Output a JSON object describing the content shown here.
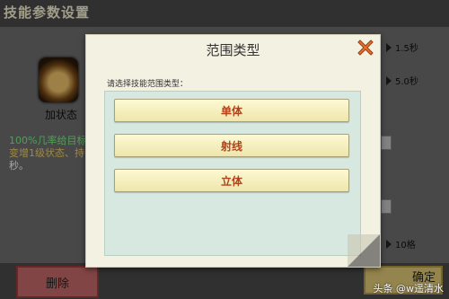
{
  "background": {
    "title": "技能参数设置",
    "skill_label": "加状态",
    "desc_line1_green": "100%几率给目标",
    "desc_line2_yellow": "变增1级状态、持",
    "desc_line3": "秒。",
    "right_values": [
      "1.5秒",
      "5.0秒",
      "10格"
    ],
    "delete_label": "删除",
    "confirm_label": "确定"
  },
  "dialog": {
    "title": "范围类型",
    "prompt": "请选择技能范围类型：",
    "options": [
      "单体",
      "射线",
      "立体"
    ]
  },
  "watermark": "头条 @w遥清水",
  "colors": {
    "close_x": "#e67332",
    "option_text": "#b0431a",
    "list_bg": "#d6e8df"
  }
}
